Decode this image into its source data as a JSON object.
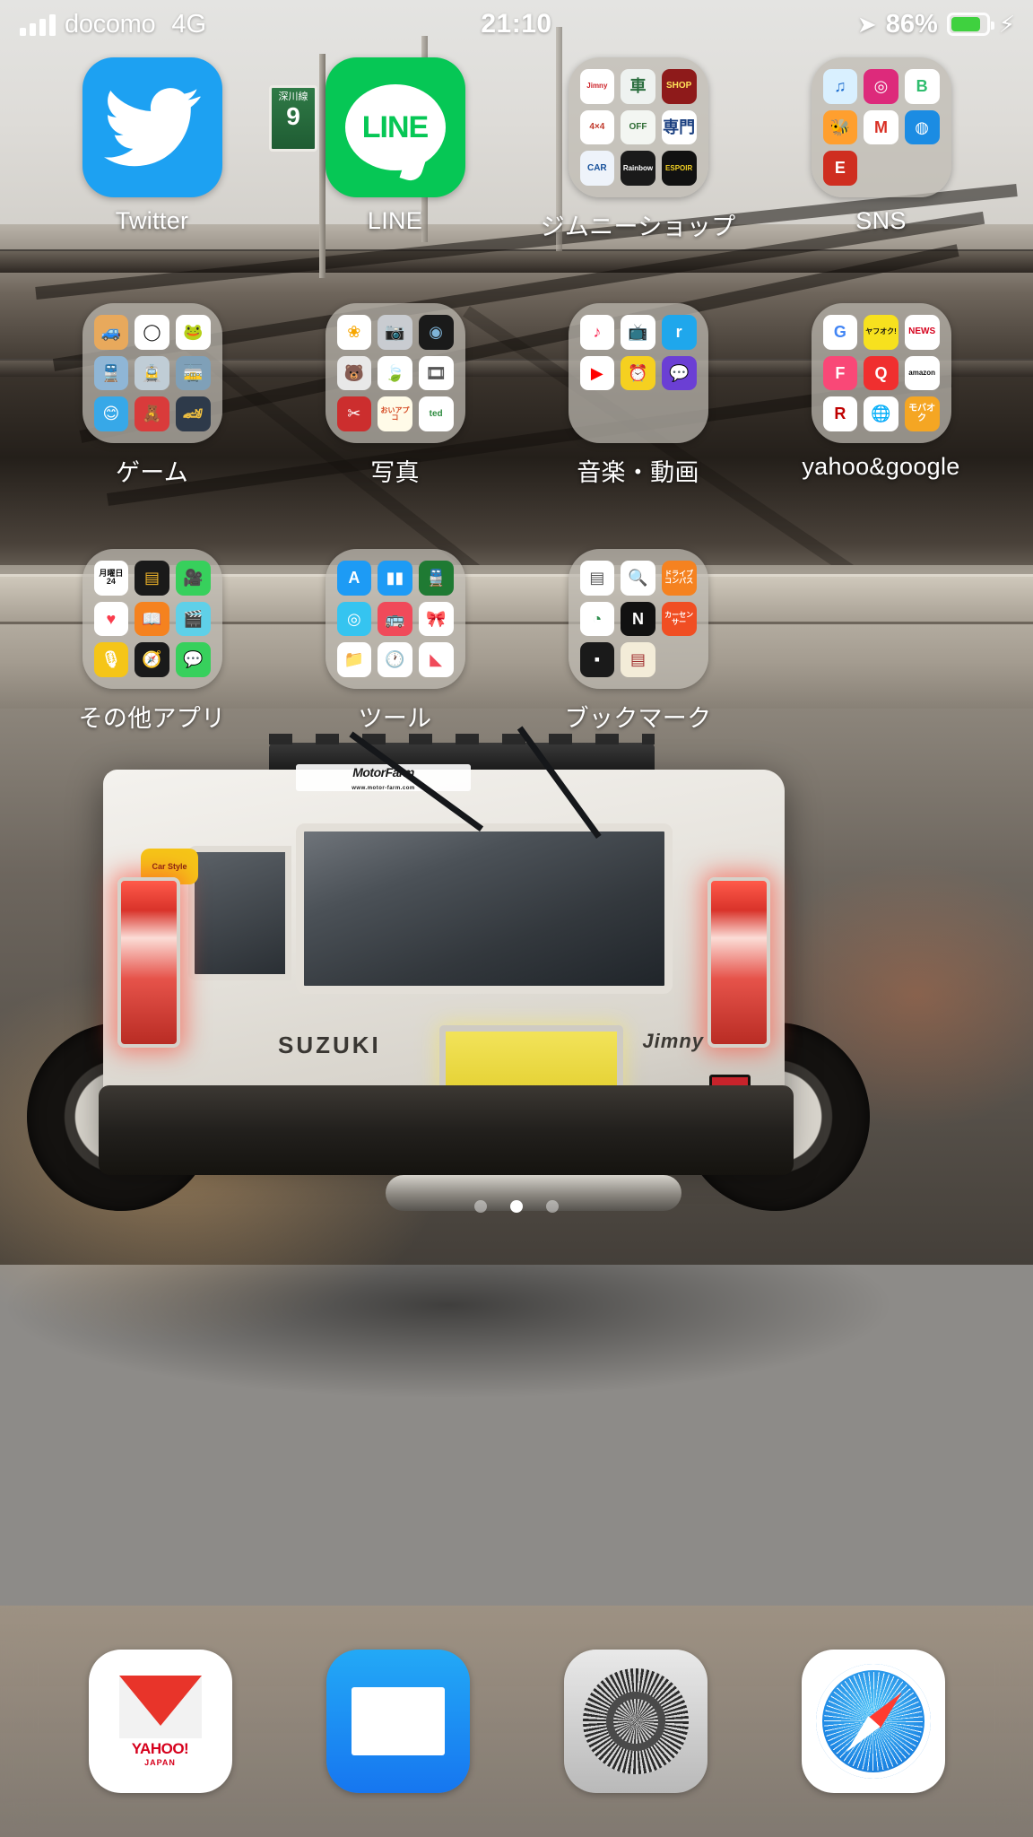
{
  "statusbar": {
    "signal_icon": "signal-bars-icon",
    "carrier": "docomo",
    "network": "4G",
    "time": "21:10",
    "location_icon": "location-arrow-icon",
    "battery_percent": "86%",
    "battery_icon": "battery-full-icon",
    "charging_icon": "lightning-bolt-icon",
    "battery_color": "#3fd13f"
  },
  "wallpaper": {
    "description": "white Suzuki Jimny parked under an elevated expressway at dusk",
    "road_sign_line": "深川線",
    "road_sign_number": "9",
    "car_sticker_motorfarm": "MotorFarm",
    "car_sticker_motorfarm_sub": "www.motor-farm.com",
    "car_sticker_carstyle": "Car Style",
    "car_brand_text": "SUZUKI",
    "car_model_text": "Jimny"
  },
  "home_screen": {
    "rows": [
      [
        {
          "name": "Twitter",
          "label": "Twitter",
          "type": "app",
          "icon": "twitter-icon",
          "color": "#1DA1F2"
        },
        {
          "name": "LINE",
          "label": "LINE",
          "type": "app",
          "icon": "line-icon",
          "color": "#06C755",
          "glyph": "LINE"
        },
        {
          "name": "jimny-shop-folder",
          "label": "ジムニーショップ",
          "type": "folder",
          "minis": [
            {
              "glyph": "Jimny",
              "bg": "#ffffff",
              "fg": "#cc2027"
            },
            {
              "glyph": "車",
              "bg": "#eef2f0",
              "fg": "#2b6e3f"
            },
            {
              "glyph": "SHOP",
              "bg": "#8e1a1a",
              "fg": "#ffe35a"
            },
            {
              "glyph": "4×4",
              "bg": "#ffffff",
              "fg": "#c0392b"
            },
            {
              "glyph": "OFF",
              "bg": "#f3f6f2",
              "fg": "#2f6d35"
            },
            {
              "glyph": "専門",
              "bg": "#ffffff",
              "fg": "#1a3f80"
            },
            {
              "glyph": "CAR",
              "bg": "#eef3fa",
              "fg": "#16509a"
            },
            {
              "glyph": "Rainbow",
              "bg": "#1a1a1a",
              "fg": "#ffffff"
            },
            {
              "glyph": "ESPOIR",
              "bg": "#111111",
              "fg": "#f2d024"
            }
          ]
        },
        {
          "name": "sns-folder",
          "label": "SNS",
          "type": "folder",
          "minis": [
            {
              "glyph": "♫",
              "bg": "#d9f0ff",
              "fg": "#1f6fd0"
            },
            {
              "glyph": "◎",
              "bg": "#dd2a7b",
              "fg": "#ffffff"
            },
            {
              "glyph": "B",
              "bg": "#ffffff",
              "fg": "#2fbd6e"
            },
            {
              "glyph": "🐝",
              "bg": "#ff9f2e",
              "fg": "#ffffff"
            },
            {
              "glyph": "M",
              "bg": "#ffffff",
              "fg": "#d93025"
            },
            {
              "glyph": "◍",
              "bg": "#1b8ce3",
              "fg": "#ffffff"
            },
            {
              "glyph": "E",
              "bg": "#cf2e20",
              "fg": "#ffffff"
            },
            {
              "glyph": "",
              "bg": "",
              "fg": ""
            },
            {
              "glyph": "",
              "bg": "",
              "fg": ""
            }
          ]
        }
      ],
      [
        {
          "name": "game-folder",
          "label": "ゲーム",
          "type": "folder",
          "minis": [
            {
              "glyph": "🚙",
              "bg": "#e8a95c",
              "fg": "#43301c"
            },
            {
              "glyph": "◯",
              "bg": "#ffffff",
              "fg": "#111111"
            },
            {
              "glyph": "🐸",
              "bg": "#ffffff",
              "fg": "#4caf50"
            },
            {
              "glyph": "🚆",
              "bg": "#8fb6d6",
              "fg": "#12406b"
            },
            {
              "glyph": "🚊",
              "bg": "#c0cdd6",
              "fg": "#8a2030"
            },
            {
              "glyph": "🚋",
              "bg": "#7fa0b8",
              "fg": "#1b3a57"
            },
            {
              "glyph": "😊",
              "bg": "#37a8e8",
              "fg": "#ffffff"
            },
            {
              "glyph": "🧸",
              "bg": "#d93b3b",
              "fg": "#ffffff"
            },
            {
              "glyph": "🏎",
              "bg": "#2e3a4a",
              "fg": "#f0c040"
            }
          ]
        },
        {
          "name": "photos-folder",
          "label": "写真",
          "type": "folder",
          "minis": [
            {
              "glyph": "❀",
              "bg": "#ffffff",
              "fg": "#f7a600"
            },
            {
              "glyph": "📷",
              "bg": "#c9ccd1",
              "fg": "#3a3a3a"
            },
            {
              "glyph": "◉",
              "bg": "#1a1a1a",
              "fg": "#7fb4d8"
            },
            {
              "glyph": "🐻",
              "bg": "#e8e8e8",
              "fg": "#6b4b2a"
            },
            {
              "glyph": "🍃",
              "bg": "#ffffff",
              "fg": "#3fae45"
            },
            {
              "glyph": "🎞",
              "bg": "#ffffff",
              "fg": "#555555"
            },
            {
              "glyph": "✂",
              "bg": "#cc2e2e",
              "fg": "#ffffff"
            },
            {
              "glyph": "おいアプコ",
              "bg": "#fffbe8",
              "fg": "#d4461f"
            },
            {
              "glyph": "ted",
              "bg": "#ffffff",
              "fg": "#2e8b3f"
            }
          ]
        },
        {
          "name": "music-video-folder",
          "label": "音楽・動画",
          "type": "folder",
          "minis": [
            {
              "glyph": "♪",
              "bg": "#ffffff",
              "fg": "#fa2b56"
            },
            {
              "glyph": "📺",
              "bg": "#ffffff",
              "fg": "#333333"
            },
            {
              "glyph": "r",
              "bg": "#1fa7ec",
              "fg": "#ffffff"
            },
            {
              "glyph": "▶",
              "bg": "#ffffff",
              "fg": "#ff0000"
            },
            {
              "glyph": "⏰",
              "bg": "#f5d020",
              "fg": "#c02020"
            },
            {
              "glyph": "💬",
              "bg": "#6b3fd4",
              "fg": "#ffffff"
            },
            {
              "glyph": "",
              "bg": "",
              "fg": ""
            },
            {
              "glyph": "",
              "bg": "",
              "fg": ""
            },
            {
              "glyph": "",
              "bg": "",
              "fg": ""
            }
          ]
        },
        {
          "name": "yahoo-google-folder",
          "label": "yahoo&google",
          "type": "folder",
          "minis": [
            {
              "glyph": "G",
              "bg": "#ffffff",
              "fg": "#4285f4"
            },
            {
              "glyph": "ヤフオク!",
              "bg": "#f7e11e",
              "fg": "#111111"
            },
            {
              "glyph": "NEWS",
              "bg": "#ffffff",
              "fg": "#d6001c"
            },
            {
              "glyph": "F",
              "bg": "#f94877",
              "fg": "#ffffff"
            },
            {
              "glyph": "Q",
              "bg": "#f02f2f",
              "fg": "#ffffff"
            },
            {
              "glyph": "amazon",
              "bg": "#ffffff",
              "fg": "#111111"
            },
            {
              "glyph": "R",
              "bg": "#ffffff",
              "fg": "#bf0000"
            },
            {
              "glyph": "🌐",
              "bg": "#ffffff",
              "fg": "#2277cc"
            },
            {
              "glyph": "モバオク",
              "bg": "#f5a623",
              "fg": "#ffffff"
            }
          ]
        }
      ],
      [
        {
          "name": "other-apps-folder",
          "label": "その他アプリ",
          "type": "folder",
          "minis": [
            {
              "glyph": "24",
              "bg": "#ffffff",
              "fg": "#111111",
              "top": "月曜日"
            },
            {
              "glyph": "▤",
              "bg": "#1a1a1a",
              "fg": "#f0b429"
            },
            {
              "glyph": "🎥",
              "bg": "#37d05c",
              "fg": "#ffffff"
            },
            {
              "glyph": "♥",
              "bg": "#ffffff",
              "fg": "#fa3c4c"
            },
            {
              "glyph": "📖",
              "bg": "#f5821f",
              "fg": "#ffffff"
            },
            {
              "glyph": "🎬",
              "bg": "#5fd0e8",
              "fg": "#111111"
            },
            {
              "glyph": "🎙",
              "bg": "#f5c518",
              "fg": "#ffffff"
            },
            {
              "glyph": "🧭",
              "bg": "#1a1a1a",
              "fg": "#ffffff"
            },
            {
              "glyph": "💬",
              "bg": "#37d05c",
              "fg": "#ffffff"
            }
          ]
        },
        {
          "name": "tools-folder",
          "label": "ツール",
          "type": "folder",
          "minis": [
            {
              "glyph": "A",
              "bg": "#1d9bf5",
              "fg": "#ffffff"
            },
            {
              "glyph": "▮▮",
              "bg": "#1d9bf5",
              "fg": "#ffffff"
            },
            {
              "glyph": "🚆",
              "bg": "#1f7a33",
              "fg": "#ffffff"
            },
            {
              "glyph": "◎",
              "bg": "#35c4f0",
              "fg": "#ffffff"
            },
            {
              "glyph": "🚌",
              "bg": "#f04a5a",
              "fg": "#ffffff"
            },
            {
              "glyph": "🎀",
              "bg": "#ffffff",
              "fg": "#e8356d"
            },
            {
              "glyph": "📁",
              "bg": "#ffffff",
              "fg": "#2f7fd0"
            },
            {
              "glyph": "🕐",
              "bg": "#ffffff",
              "fg": "#111111"
            },
            {
              "glyph": "◣",
              "bg": "#ffffff",
              "fg": "#f04a5a"
            }
          ]
        },
        {
          "name": "bookmark-folder",
          "label": "ブックマーク",
          "type": "folder",
          "minis": [
            {
              "glyph": "▤",
              "bg": "#ffffff",
              "fg": "#555555"
            },
            {
              "glyph": "🔍",
              "bg": "#ffffff",
              "fg": "#8b3fd0"
            },
            {
              "glyph": "ドライブコンパス",
              "bg": "#f58220",
              "fg": "#ffffff"
            },
            {
              "glyph": "◔",
              "bg": "#ffffff",
              "fg": "#2f8f4f"
            },
            {
              "glyph": "N",
              "bg": "#111111",
              "fg": "#ffffff"
            },
            {
              "glyph": "カーセンサー",
              "bg": "#f04e23",
              "fg": "#ffffff"
            },
            {
              "glyph": "▪",
              "bg": "#1a1a1a",
              "fg": "#ffffff"
            },
            {
              "glyph": "▤",
              "bg": "#f3ecd8",
              "fg": "#a03030"
            },
            {
              "glyph": "",
              "bg": "",
              "fg": ""
            }
          ]
        },
        {
          "name": "empty-slot",
          "label": "",
          "type": "empty"
        }
      ]
    ],
    "page_dots": {
      "count": 3,
      "active_index": 1
    }
  },
  "dock": {
    "items": [
      {
        "name": "yahoo-japan-mail",
        "label": "YAHOO!",
        "sub": "JAPAN",
        "icon": "yahoo-mail-icon"
      },
      {
        "name": "mail",
        "label": "",
        "icon": "mail-icon"
      },
      {
        "name": "settings",
        "label": "",
        "icon": "gear-icon"
      },
      {
        "name": "safari",
        "label": "",
        "icon": "compass-icon"
      }
    ]
  }
}
